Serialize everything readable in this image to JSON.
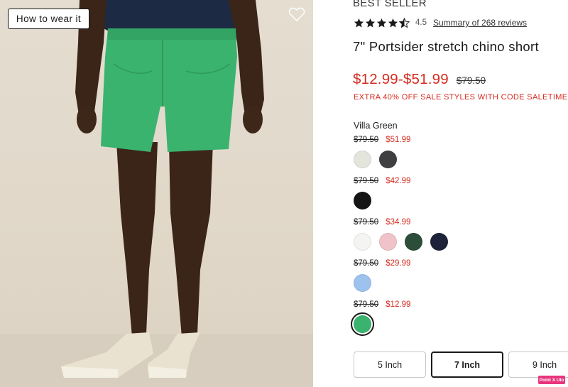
{
  "photo": {
    "wear_button_label": "How to wear it",
    "favorite_icon": "heart-outline-icon"
  },
  "product": {
    "badge": "BEST SELLER",
    "rating": 4.5,
    "rating_text": "4.5",
    "reviews_link": "Summary of 268 reviews",
    "title": "7\" Portsider stretch chino short",
    "price_range": "$12.99-$51.99",
    "original_price": "$79.50",
    "promo": "EXTRA 40% OFF SALE STYLES WITH CODE SALETIME",
    "selected_color": "Villa Green"
  },
  "price_tiers": [
    {
      "original": "$79.50",
      "sale": "$51.99",
      "swatches": [
        "#e3e5dc",
        "#3f3f41"
      ]
    },
    {
      "original": "$79.50",
      "sale": "$42.99",
      "swatches": [
        "#151515"
      ]
    },
    {
      "original": "$79.50",
      "sale": "$34.99",
      "swatches": [
        "#f4f4f2",
        "#efc3c8",
        "#2c4d3a",
        "#1d2338"
      ]
    },
    {
      "original": "$79.50",
      "sale": "$29.99",
      "swatches": [
        "#9ec2ee"
      ]
    },
    {
      "original": "$79.50",
      "sale": "$12.99",
      "swatches": [
        "#3ab36e"
      ]
    }
  ],
  "selected_swatch": "#3ab36e",
  "sizes": [
    {
      "label": "5 Inch",
      "selected": false
    },
    {
      "label": "7 Inch",
      "selected": true
    },
    {
      "label": "9 Inch",
      "selected": false
    }
  ],
  "colors": {
    "sale_red": "#d52b1e",
    "shorts_green": "#3ab36e",
    "text_dark": "#1a1a1a"
  },
  "extension_badge": "Point X Ulo"
}
